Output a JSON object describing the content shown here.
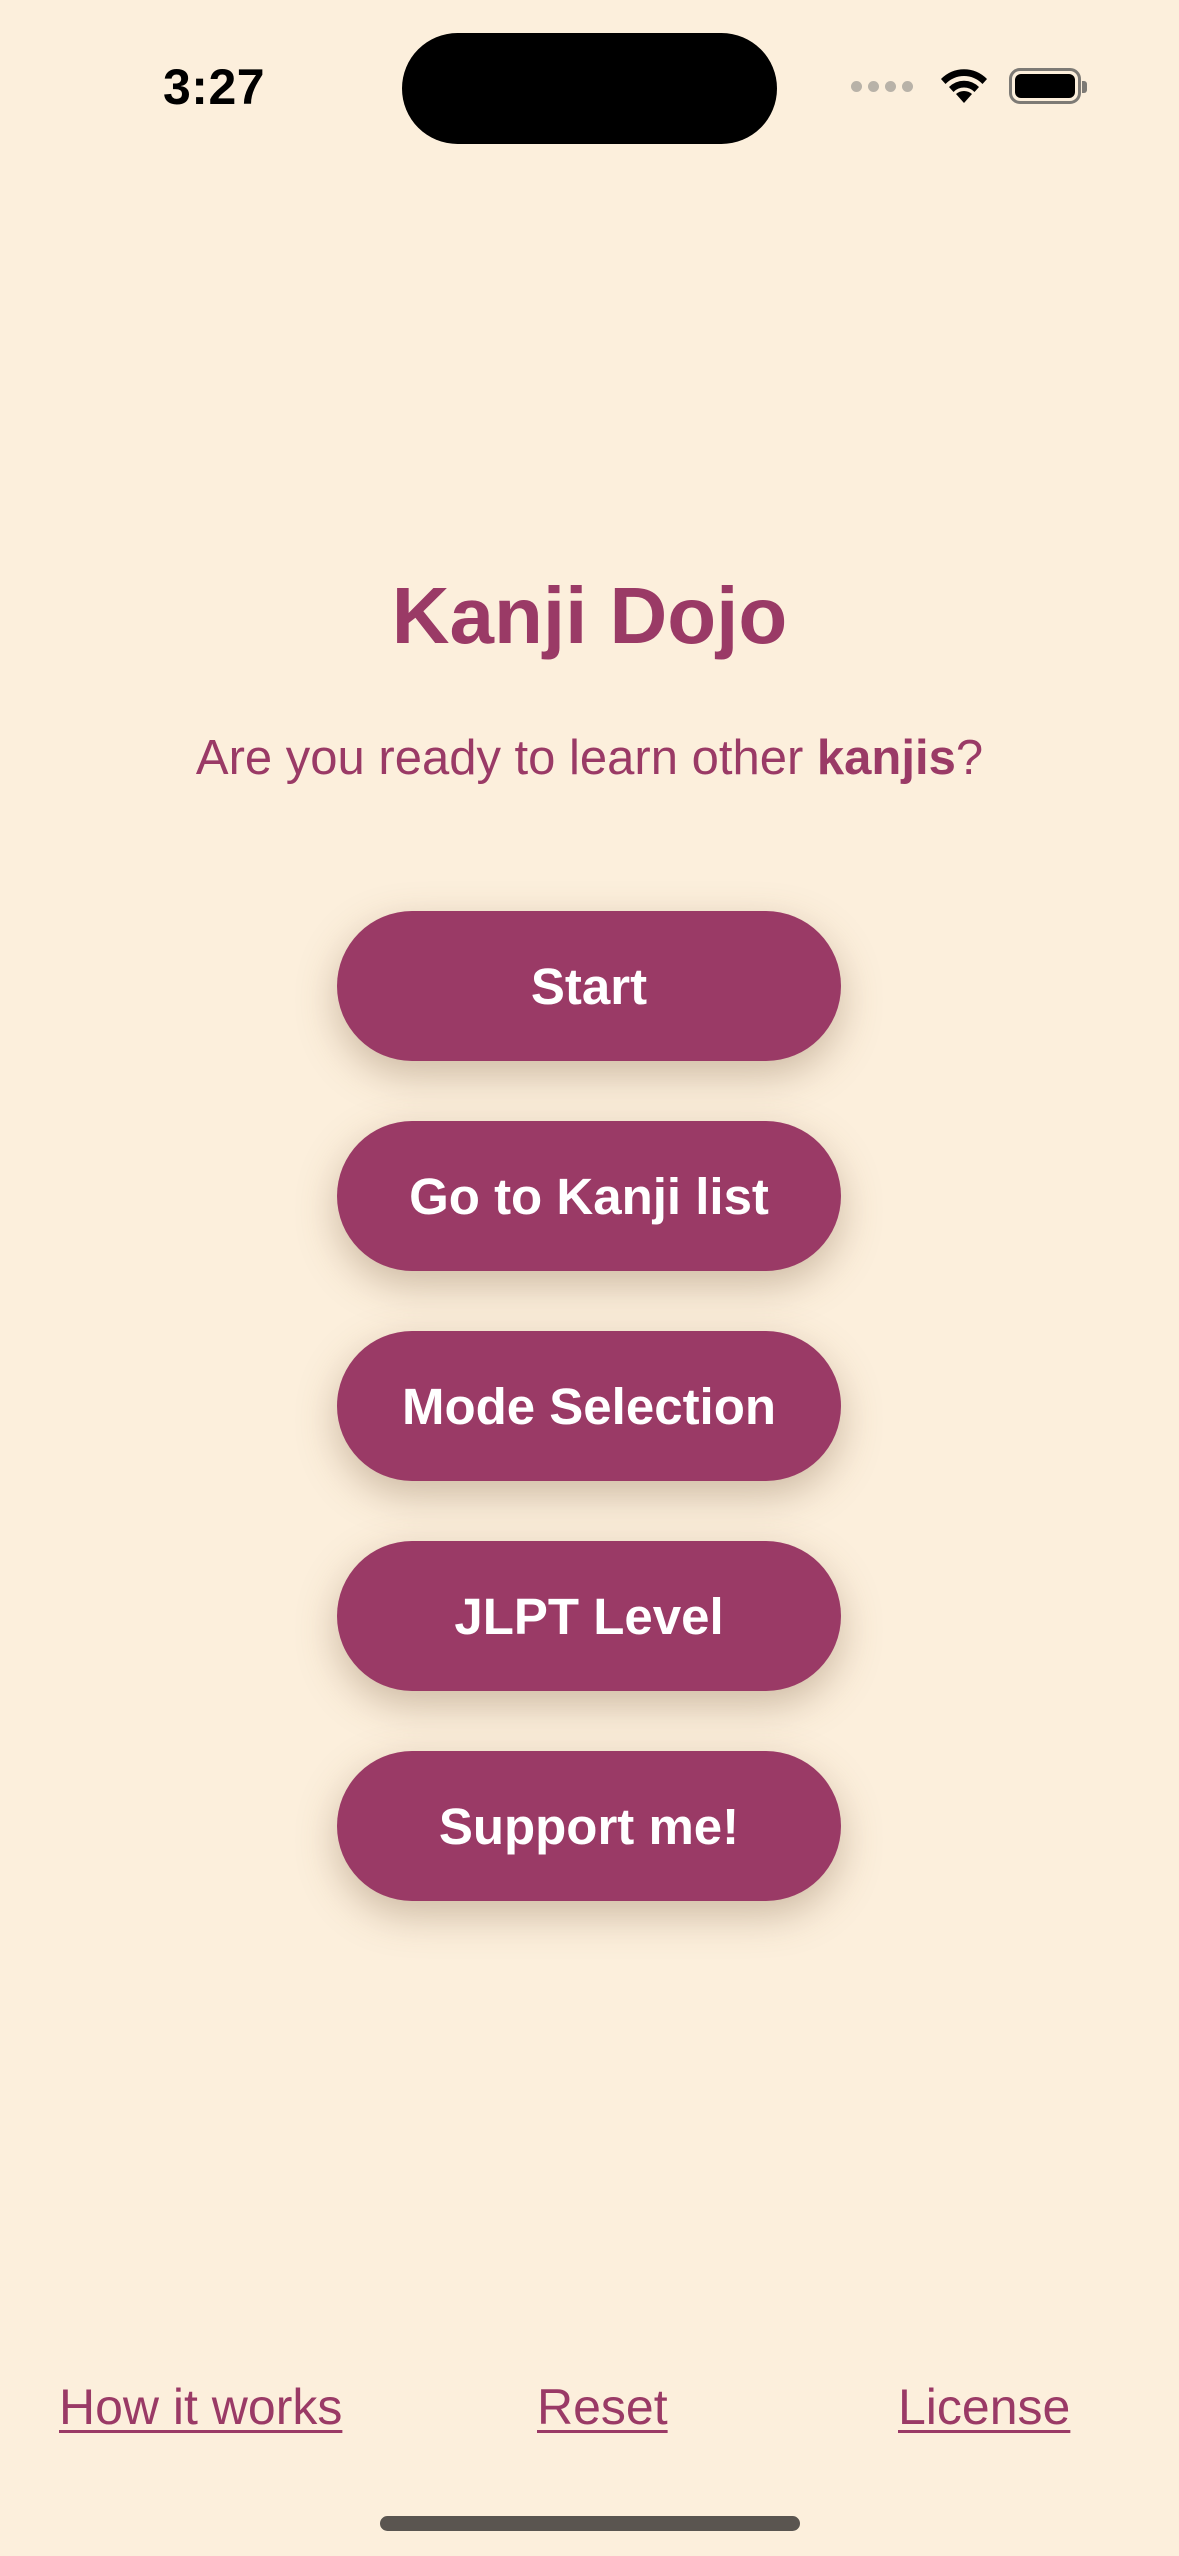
{
  "status_bar": {
    "time": "3:27",
    "icons": [
      "cellular-signal-icon",
      "wifi-icon",
      "battery-icon"
    ]
  },
  "header": {
    "title": "Kanji Dojo",
    "subtitle_prefix": "Are you ready to learn other ",
    "subtitle_emphasis": "kanjis",
    "subtitle_suffix": "?"
  },
  "menu": {
    "start_label": "Start",
    "kanji_list_label": "Go to Kanji list",
    "mode_selection_label": "Mode Selection",
    "jlpt_level_label": "JLPT Level",
    "support_label": "Support me!"
  },
  "footer": {
    "how_it_works_label": "How it works",
    "reset_label": "Reset",
    "license_label": "License"
  },
  "colors": {
    "background": "#fcefdc",
    "accent": "#9a3a66",
    "button_text": "#ffffff"
  }
}
